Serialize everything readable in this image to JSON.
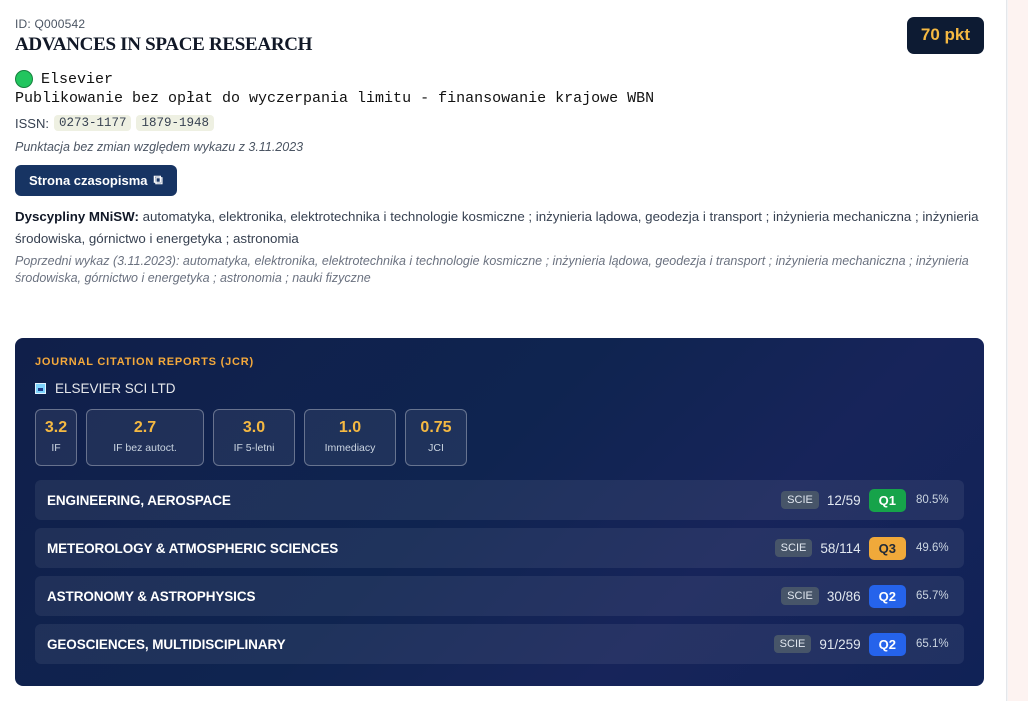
{
  "journal": {
    "id_label": "ID: Q000542",
    "title": "ADVANCES IN SPACE RESEARCH",
    "points": "70 pkt",
    "publisher": "Elsevier",
    "status_color": "#22c55e",
    "oa_note": "Publikowanie bez opłat do wyczerpania limitu - finansowanie krajowe WBN",
    "issn_label": "ISSN:",
    "issn": [
      "0273-1177",
      "1879-1948"
    ],
    "change_note": "Punktacja bez zmian względem wykazu z 3.11.2023",
    "site_button": "Strona czasopisma",
    "site_icon": "external-link-icon",
    "disciplines_label": "Dyscypliny MNiSW:",
    "disciplines": "automatyka, elektronika, elektrotechnika i technologie kosmiczne ; inżynieria lądowa, geodezja i transport ; inżynieria mechaniczna ; inżynieria środowiska, górnictwo i energetyka ; astronomia",
    "previous_list": "Poprzedni wykaz (3.11.2023): automatyka, elektronika, elektrotechnika i technologie kosmiczne ; inżynieria lądowa, geodezja i transport ; inżynieria mechaniczna ; inżynieria środowiska, górnictwo i energetyka ; astronomia ; nauki fizyczne"
  },
  "jcr": {
    "title": "JOURNAL CITATION REPORTS (JCR)",
    "publisher": "ELSEVIER SCI LTD",
    "accent": "#f5b942",
    "metrics": [
      {
        "value": "3.2",
        "label": "IF"
      },
      {
        "value": "2.7",
        "label": "IF bez autoct."
      },
      {
        "value": "3.0",
        "label": "IF 5-letni"
      },
      {
        "value": "1.0",
        "label": "Immediacy"
      },
      {
        "value": "0.75",
        "label": "JCI"
      }
    ],
    "categories": [
      {
        "name": "ENGINEERING, AEROSPACE",
        "index": "SCIE",
        "rank": "12/59",
        "quartile": "Q1",
        "percentile": "80.5%"
      },
      {
        "name": "METEOROLOGY & ATMOSPHERIC SCIENCES",
        "index": "SCIE",
        "rank": "58/114",
        "quartile": "Q3",
        "percentile": "49.6%"
      },
      {
        "name": "ASTRONOMY & ASTROPHYSICS",
        "index": "SCIE",
        "rank": "30/86",
        "quartile": "Q2",
        "percentile": "65.7%"
      },
      {
        "name": "GEOSCIENCES, MULTIDISCIPLINARY",
        "index": "SCIE",
        "rank": "91/259",
        "quartile": "Q2",
        "percentile": "65.1%"
      }
    ]
  }
}
